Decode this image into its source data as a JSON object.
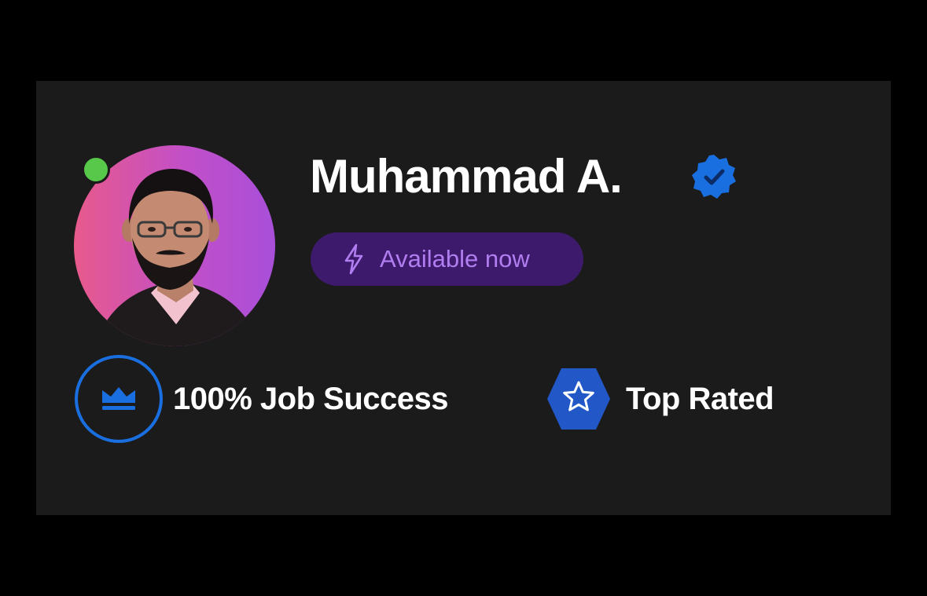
{
  "profile": {
    "name": "Muhammad A.",
    "availability": "Available now",
    "online": true
  },
  "stats": {
    "job_success": "100% Job Success",
    "top_rated": "Top Rated"
  },
  "colors": {
    "background": "#000000",
    "card": "#1b1b1b",
    "accent_blue": "#1a6fe0",
    "availability_bg": "#3d1a6b",
    "availability_text": "#b07ef0",
    "online": "#57c84a",
    "badge_blue": "#2157c7"
  },
  "icons": {
    "verified": "verified-badge-icon",
    "availability": "lightning-bolt-icon",
    "job_success": "crown-icon",
    "top_rated": "star-icon"
  }
}
